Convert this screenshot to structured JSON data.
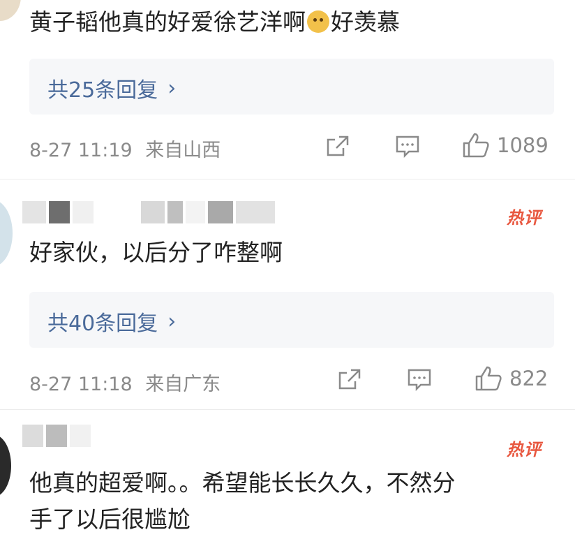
{
  "comments": [
    {
      "content": "黄子韬他真的好爱徐艺洋啊",
      "content_suffix": "好羡慕",
      "emoji": "doge-emoji",
      "reply_label": "共25条回复",
      "time": "8-27 11:19",
      "location": "来自山西",
      "likes": "1089"
    },
    {
      "badge": "热评",
      "content": "好家伙，以后分了咋整啊",
      "reply_label": "共40条回复",
      "time": "8-27 11:18",
      "location": "来自广东",
      "likes": "822"
    },
    {
      "badge": "热评",
      "content_line1": "他真的超爱啊。。希望能长长久久，不然分",
      "content_line2": "手了以后很尴尬"
    }
  ],
  "icons": {
    "share": "share-icon",
    "comment": "comment-icon",
    "like": "thumbs-up-icon",
    "chevron": "chevron-right-icon"
  },
  "colors": {
    "link": "#4a6a9a",
    "hot_badge": "#e8573f",
    "meta": "#8a8a8a",
    "reply_bg": "#f6f7f9"
  }
}
